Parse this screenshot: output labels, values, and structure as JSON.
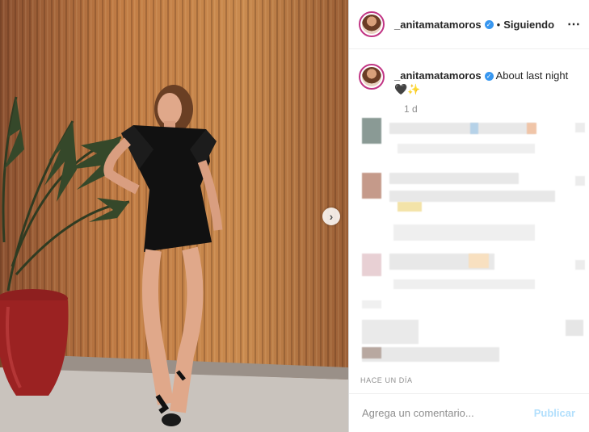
{
  "post": {
    "username": "_anitamatamoros",
    "follow_status": "Siguiendo",
    "separator": "•",
    "more_icon": "⋯",
    "next_icon": "›"
  },
  "caption": {
    "username": "_anitamatamoros",
    "text": "About last night",
    "emoji": "🖤✨",
    "time": "1 d"
  },
  "footer": {
    "posted_time": "HACE UN DÍA"
  },
  "comment_box": {
    "placeholder": "Agrega un comentario...",
    "publish_label": "Publicar"
  },
  "colors": {
    "verified": "#3897f0",
    "publish_disabled": "#b2dffc",
    "wall": "#b8723d"
  },
  "icons": {
    "verified": "verified-badge-icon",
    "more": "more-options-icon",
    "next": "chevron-right-icon"
  }
}
